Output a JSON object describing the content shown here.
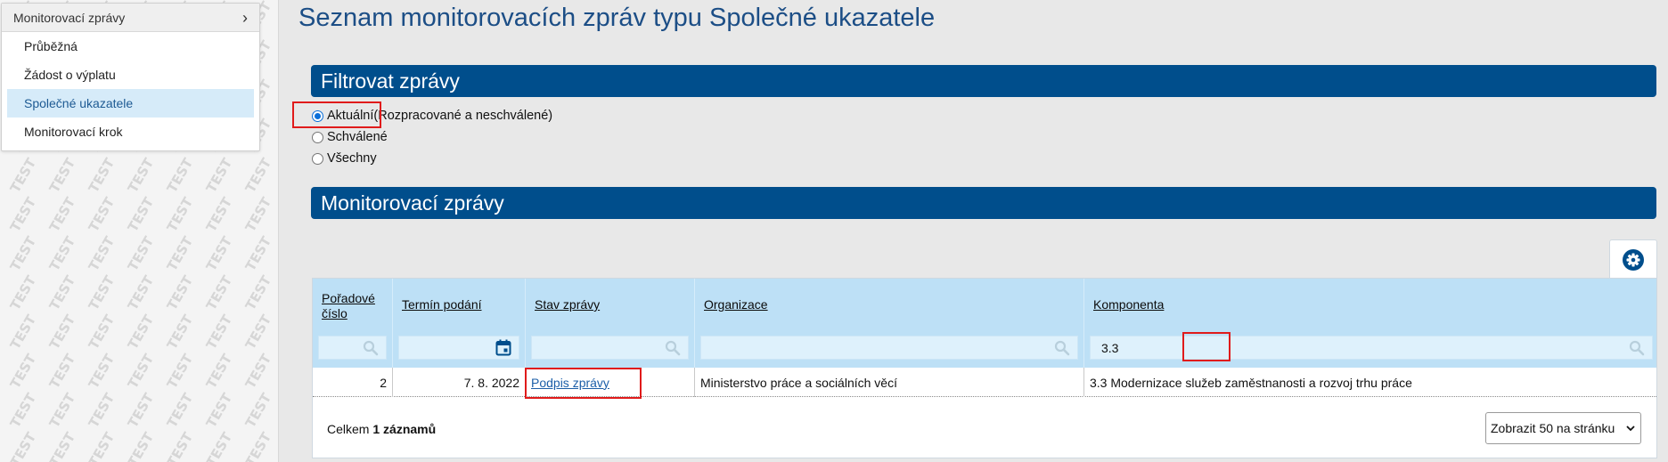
{
  "sidebar": {
    "menu_title": "Monitorovací zprávy",
    "items": [
      {
        "label": "Průběžná",
        "active": false
      },
      {
        "label": "Žádost o výplatu",
        "active": false
      },
      {
        "label": "Společné ukazatele",
        "active": true
      },
      {
        "label": "Monitorovací krok",
        "active": false
      }
    ],
    "watermark": "TEST"
  },
  "page_title": "Seznam monitorovacích zpráv typu Společné ukazatele",
  "filter_section": {
    "title": "Filtrovat zprávy",
    "options": [
      {
        "label": "Aktuální",
        "hint": " (Rozpracované a neschválené)",
        "checked": true
      },
      {
        "label": "Schválené",
        "hint": "",
        "checked": false
      },
      {
        "label": "Všechny",
        "hint": "",
        "checked": false
      }
    ]
  },
  "reports_section": {
    "title": "Monitorovací zprávy",
    "settings_icon": "gear-icon",
    "columns": [
      {
        "label_line1": "Pořadové",
        "label_line2": "číslo",
        "filter_value": "",
        "filter_icon": "search-icon"
      },
      {
        "label_line1": "Termín podání",
        "label_line2": "",
        "filter_value": "",
        "filter_icon": "calendar-icon"
      },
      {
        "label_line1": "Stav zprávy",
        "label_line2": "",
        "filter_value": "",
        "filter_icon": "search-icon"
      },
      {
        "label_line1": "Organizace",
        "label_line2": "",
        "filter_value": "",
        "filter_icon": "search-icon"
      },
      {
        "label_line1": "Komponenta",
        "label_line2": "",
        "filter_value": "3.3",
        "filter_icon": "search-icon"
      }
    ],
    "rows": [
      {
        "number": "2",
        "date": "7. 8. 2022",
        "status": "Podpis zprávy",
        "organization": "Ministerstvo práce a sociálních věcí",
        "component": "3.3 Modernizace služeb zaměstnanosti a rozvoj trhu práce"
      }
    ],
    "footer": {
      "total_prefix": "Celkem ",
      "total_count": "1 záznamů"
    },
    "page_size": "Zobrazit 50 na stránku"
  },
  "colors": {
    "accent": "#004e8c",
    "title": "#1c4e86",
    "table_header": "#bde0f6",
    "highlight": "#e01b1b"
  }
}
